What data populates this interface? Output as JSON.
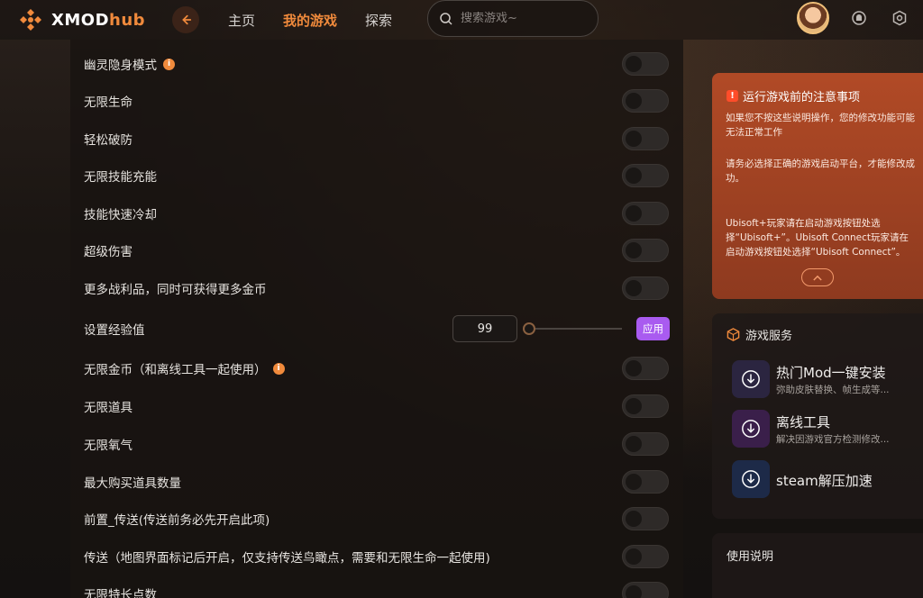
{
  "header": {
    "logo_main": "XMOD",
    "logo_accent": "hub",
    "nav": [
      {
        "label": "主页",
        "active": false
      },
      {
        "label": "我的游戏",
        "active": true
      },
      {
        "label": "探索",
        "active": false
      }
    ],
    "search_placeholder": "搜索游戏~"
  },
  "mods": [
    {
      "label": "幽灵隐身模式",
      "info": true,
      "type": "toggle",
      "on": false
    },
    {
      "label": "无限生命",
      "info": false,
      "type": "toggle",
      "on": false
    },
    {
      "label": "轻松破防",
      "info": false,
      "type": "toggle",
      "on": false
    },
    {
      "label": "无限技能充能",
      "info": false,
      "type": "toggle",
      "on": false
    },
    {
      "label": "技能快速冷却",
      "info": false,
      "type": "toggle",
      "on": false
    },
    {
      "label": "超级伤害",
      "info": false,
      "type": "toggle",
      "on": false
    },
    {
      "label": "更多战利品，同时可获得更多金币",
      "info": false,
      "type": "toggle",
      "on": false
    },
    {
      "label": "设置经验值",
      "info": false,
      "type": "value",
      "value": "99",
      "slider_level": 0,
      "apply_label": "应用"
    },
    {
      "label": "无限金币（和离线工具一起使用）",
      "info": true,
      "type": "toggle",
      "on": false
    },
    {
      "label": "无限道具",
      "info": false,
      "type": "toggle",
      "on": false
    },
    {
      "label": "无限氧气",
      "info": false,
      "type": "toggle",
      "on": false
    },
    {
      "label": "最大购买道具数量",
      "info": false,
      "type": "toggle",
      "on": false
    },
    {
      "label": "前置_传送(传送前务必先开启此项)",
      "info": false,
      "type": "toggle",
      "on": false
    },
    {
      "label": "传送（地图界面标记后开启，仅支持传送鸟瞰点，需要和无限生命一起使用)",
      "info": false,
      "type": "toggle",
      "on": false
    },
    {
      "label": "无限特长点数",
      "info": false,
      "type": "toggle",
      "on": false
    }
  ],
  "notice": {
    "title": "运行游戏前的注意事项",
    "paragraphs": [
      "如果您不按这些说明操作，您的修改功能可能无法正常工作",
      "请务必选择正确的游戏启动平台，才能修改成功。",
      "Ubisoft+玩家请在启动游戏按钮处选择“Ubisoft+”。Ubisoft Connect玩家请在启动游戏按钮处选择“Ubisoft Connect”。"
    ]
  },
  "services": {
    "title": "游戏服务",
    "items": [
      {
        "name": "热门Mod一键安装",
        "sub": "弥助皮肤替换、帧生成等..."
      },
      {
        "name": "离线工具",
        "sub": "解决因游戏官方检测修改..."
      },
      {
        "name": "steam解压加速",
        "sub": ""
      }
    ]
  },
  "usage": {
    "title": "使用说明"
  },
  "colors": {
    "accent": "#f08a3c",
    "apply": "#a95bf0",
    "notice_bg": "#a64424"
  }
}
